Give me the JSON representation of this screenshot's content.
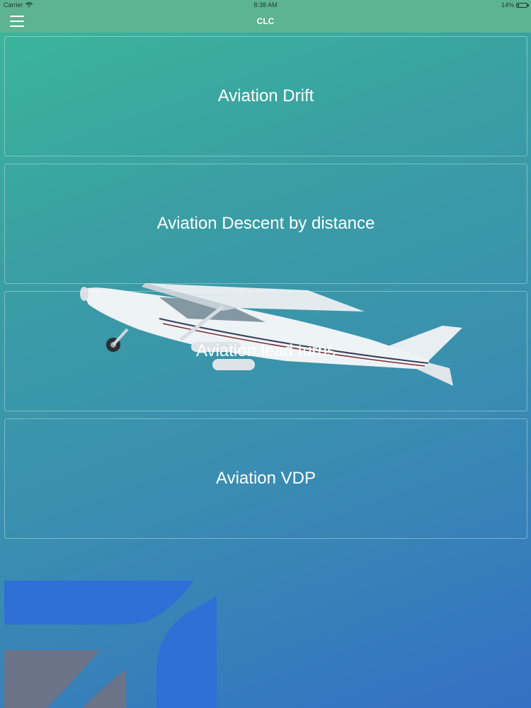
{
  "status_bar": {
    "carrier": "Carrier",
    "time": "8:38 AM",
    "battery": "14%",
    "battery_level": 0.14
  },
  "nav": {
    "title": "CLC",
    "menu_icon": "hamburger-menu-icon"
  },
  "cards": [
    {
      "label": "Aviation Drift"
    },
    {
      "label": "Aviation Descent by distance"
    },
    {
      "label": "Aviation lead turns"
    },
    {
      "label": "Aviation VDP"
    }
  ],
  "colors": {
    "nav_bg": "#5db392",
    "gradient_start": "#3bb89a",
    "gradient_end": "#3470c4",
    "logo_blue": "#2f6fd6",
    "logo_gray": "#6b7388"
  }
}
